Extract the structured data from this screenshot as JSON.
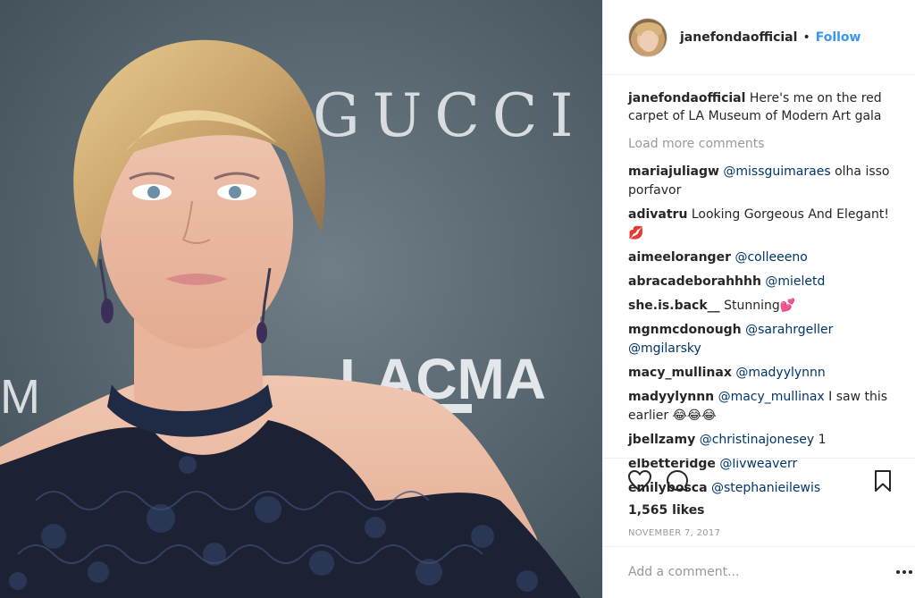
{
  "post": {
    "photo": {
      "backdrop_text_1": "GUCCI",
      "backdrop_text_2": "LACMA",
      "backdrop_text_3": "M"
    },
    "header": {
      "username": "janefondaofficial",
      "separator": "•",
      "follow_label": "Follow"
    },
    "caption": {
      "username": "janefondaofficial",
      "text": "Here's me on the red carpet of LA Museum of Modern Art gala"
    },
    "load_more": "Load more comments",
    "comments": [
      {
        "user": "mariajuliagw",
        "mention": "@missguimaraes",
        "text": " olha isso porfavor"
      },
      {
        "user": "adivatru",
        "mention": "",
        "text": "Looking Gorgeous And Elegant! 💋"
      },
      {
        "user": "aimeeloranger",
        "mention": "@colleeeno",
        "text": ""
      },
      {
        "user": "abracadeborahhhh",
        "mention": "@mieletd",
        "text": ""
      },
      {
        "user": "she.is.back__",
        "mention": "",
        "text": "Stunning💕"
      },
      {
        "user": "mgnmcdonough",
        "mention": "@sarahrgeller @mgilarsky",
        "text": ""
      },
      {
        "user": "macy_mullinax",
        "mention": "@madyylynnn",
        "text": ""
      },
      {
        "user": "madyylynnn",
        "mention": "@macy_mullinax",
        "text": " I saw this earlier 😂😂😂"
      },
      {
        "user": "jbellzamy",
        "mention": "@christinajonesey",
        "text": " 1"
      },
      {
        "user": "elbetteridge",
        "mention": "@livweaverr",
        "text": ""
      },
      {
        "user": "emilybosca",
        "mention": "@stephanieilewis",
        "text": ""
      }
    ],
    "actions": {
      "like_icon": "heart-icon",
      "comment_icon": "comment-bubble-icon",
      "save_icon": "bookmark-icon",
      "likes": "1,565 likes",
      "date": "NOVEMBER 7, 2017",
      "add_comment_placeholder": "Add a comment...",
      "more_icon": "more-options-icon"
    },
    "colors": {
      "link": "#3897f0",
      "mention": "#003569",
      "muted": "#999999"
    }
  }
}
